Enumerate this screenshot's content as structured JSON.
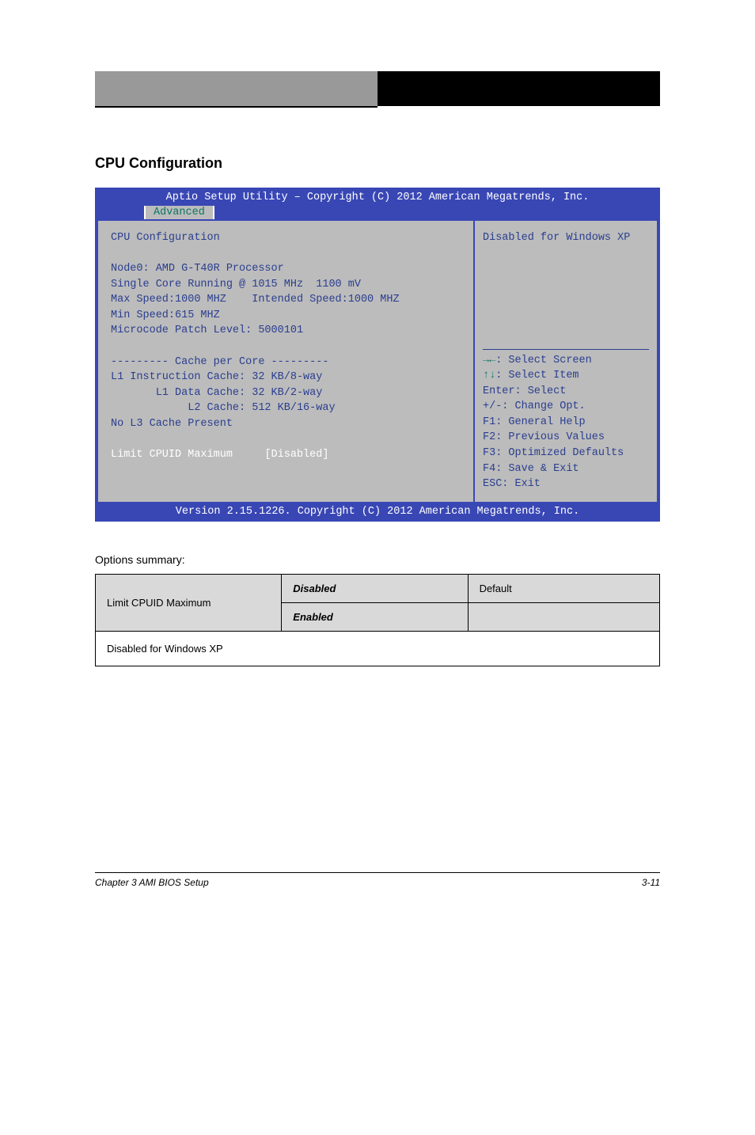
{
  "section_title": "CPU Configuration",
  "bios": {
    "header": "Aptio Setup Utility – Copyright (C) 2012 American Megatrends, Inc.",
    "tab": "Advanced",
    "title_line": "CPU Configuration",
    "info_block": "Node0: AMD G-T40R Processor\nSingle Core Running @ 1015 MHz  1100 mV\nMax Speed:1000 MHZ    Intended Speed:1000 MHZ\nMin Speed:615 MHZ\nMicrocode Patch Level: 5000101\n\n--------- Cache per Core ---------\nL1 Instruction Cache: 32 KB/8-way\n       L1 Data Cache: 32 KB/2-way\n            L2 Cache: 512 KB/16-way\nNo L3 Cache Present",
    "selected_item_label": "Limit CPUID Maximum",
    "selected_item_value": "[Disabled]",
    "side_help": "Disabled for Windows XP",
    "keys": {
      "k1": {
        "sym": "→←",
        "txt": ": Select Screen"
      },
      "k2": {
        "sym": "↑↓",
        "txt": ": Select Item"
      },
      "k3": {
        "lbl": "Enter: Select"
      },
      "k4": {
        "lbl": "+/-: Change Opt."
      },
      "k5": {
        "lbl": "F1: General Help"
      },
      "k6": {
        "lbl": "F2: Previous Values"
      },
      "k7": {
        "lbl": "F3: Optimized Defaults"
      },
      "k8": {
        "lbl": "F4: Save & Exit"
      },
      "k9": {
        "lbl": "ESC: Exit"
      }
    },
    "footer": "Version 2.15.1226. Copyright (C) 2012 American Megatrends, Inc."
  },
  "options_label": "Options summary:",
  "opt_table": {
    "r1c1": "Limit CPUID Maximum",
    "r1c2": "Disabled",
    "r1c3": "Default",
    "r2c2": "Enabled",
    "r2c3": "",
    "desc": "Disabled for Windows XP"
  },
  "footer": {
    "left": "Chapter 3 AMI BIOS Setup",
    "right": "3-11"
  }
}
